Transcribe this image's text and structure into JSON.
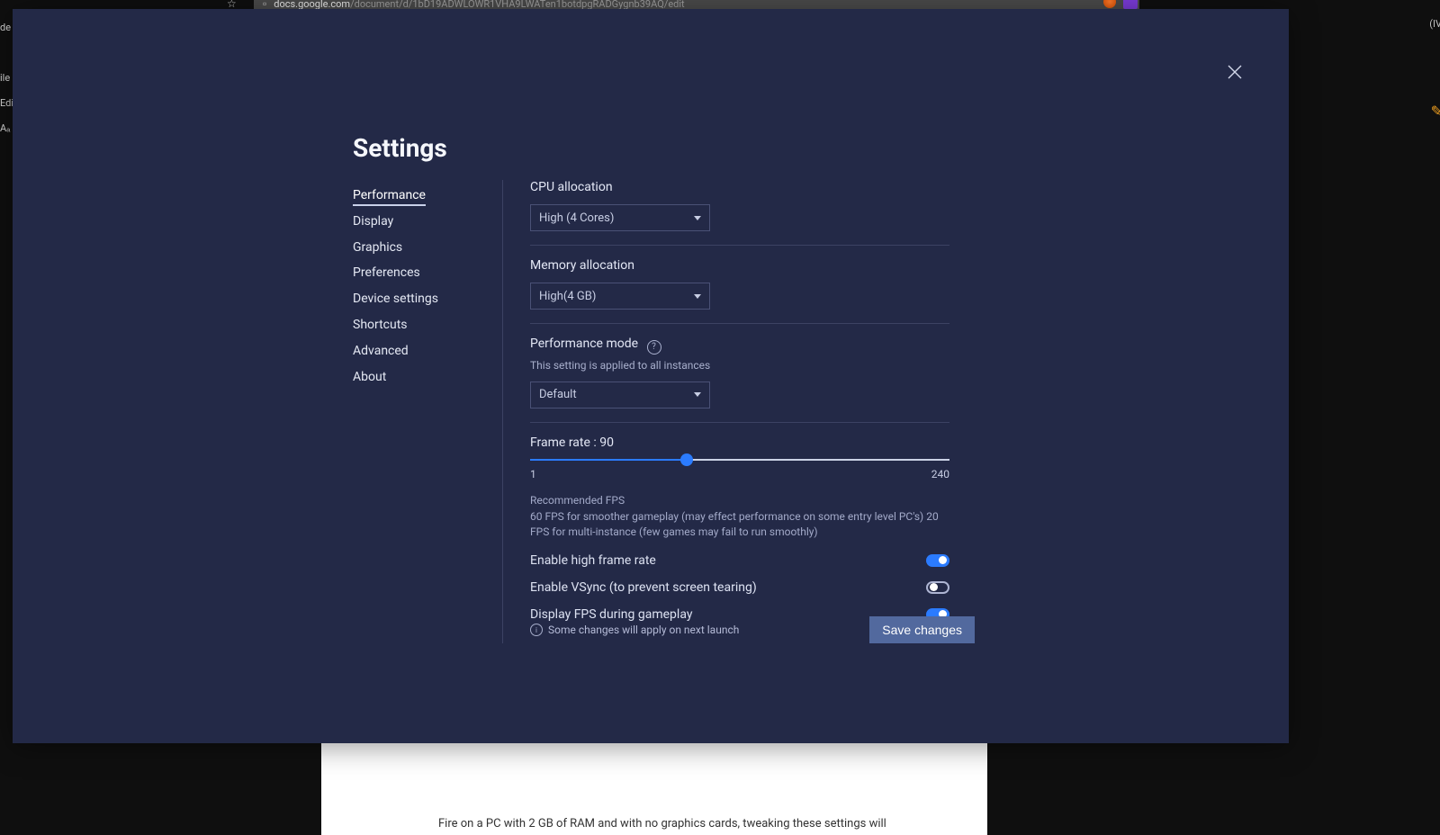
{
  "browser": {
    "url_domain": "docs.google.com",
    "url_path": "/document/d/1bD19ADWLOWR1VHA9LWATen1botdpgRADGygnb39AQ/edit",
    "left_strip": [
      "de",
      "ile",
      "Edi",
      "Aₐ"
    ],
    "right_fragment": "(IV",
    "bottom_text": "Fire on a PC with 2 GB of RAM and with no graphics cards, tweaking these settings will"
  },
  "modal": {
    "title": "Settings",
    "sidebar": {
      "active_index": 0,
      "items": [
        "Performance",
        "Display",
        "Graphics",
        "Preferences",
        "Device settings",
        "Shortcuts",
        "Advanced",
        "About"
      ]
    },
    "cpu": {
      "label": "CPU allocation",
      "selected": "High (4 Cores)"
    },
    "memory": {
      "label": "Memory allocation",
      "selected": "High(4 GB)"
    },
    "perf_mode": {
      "label": "Performance mode",
      "subtext": "This setting is applied to all instances",
      "selected": "Default"
    },
    "frame_rate": {
      "label_prefix": "Frame rate : ",
      "value": 90,
      "min": 1,
      "max": 240,
      "recommended_title": "Recommended FPS",
      "recommended_body": "60 FPS for smoother gameplay (may effect performance on some entry level PC's) 20 FPS for multi-instance (few games may fail to run smoothly)"
    },
    "toggles": {
      "high_frame_rate": {
        "label": "Enable high frame rate",
        "on": true
      },
      "vsync": {
        "label": "Enable VSync (to prevent screen tearing)",
        "on": false
      },
      "display_fps": {
        "label": "Display FPS during gameplay",
        "on": true
      }
    },
    "footer_note": "Some changes will apply on next launch",
    "save_label": "Save changes"
  }
}
